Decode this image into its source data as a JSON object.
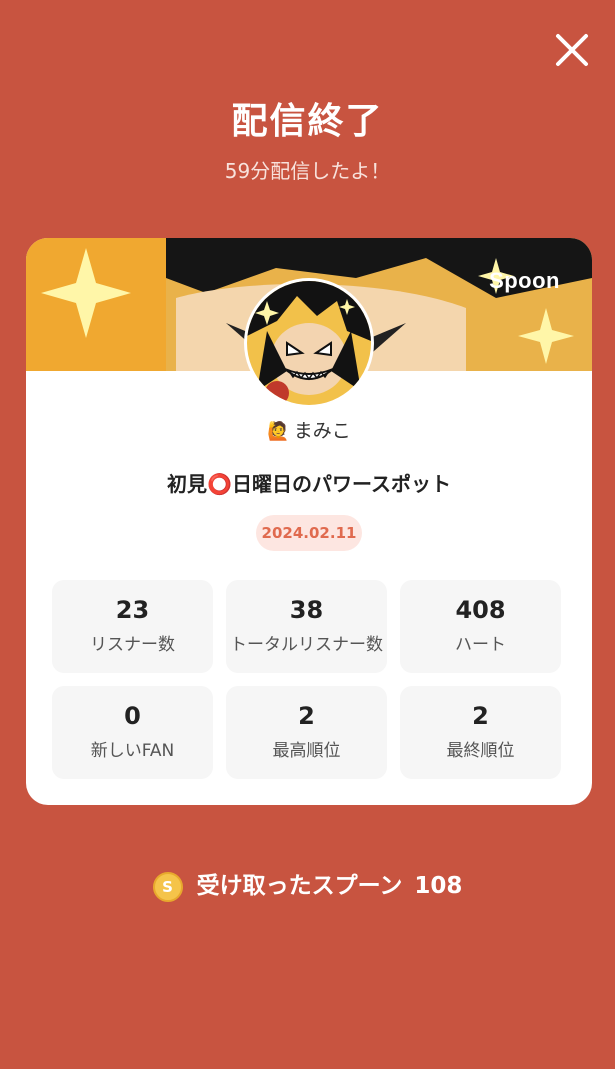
{
  "header": {
    "title": "配信終了",
    "subtitle": "59分配信したよ！",
    "close_icon": "close-icon"
  },
  "card": {
    "brand": "Spoon",
    "user": {
      "emoji": "🙋",
      "name": "まみこ"
    },
    "stream_title": "初見⭕日曜日のパワースポット",
    "date": "2024.02.11",
    "stats": [
      {
        "value": "23",
        "label": "リスナー数"
      },
      {
        "value": "38",
        "label": "トータルリスナー数"
      },
      {
        "value": "408",
        "label": "ハート"
      },
      {
        "value": "0",
        "label": "新しいFAN"
      },
      {
        "value": "2",
        "label": "最高順位"
      },
      {
        "value": "2",
        "label": "最終順位"
      }
    ]
  },
  "footer": {
    "coin_icon": "coin-icon",
    "coin_letter": "S",
    "label": "受け取ったスプーン",
    "amount": "108"
  },
  "colors": {
    "background": "#c85440",
    "badge_bg": "#fde6e1",
    "badge_text": "#e06a4e"
  }
}
